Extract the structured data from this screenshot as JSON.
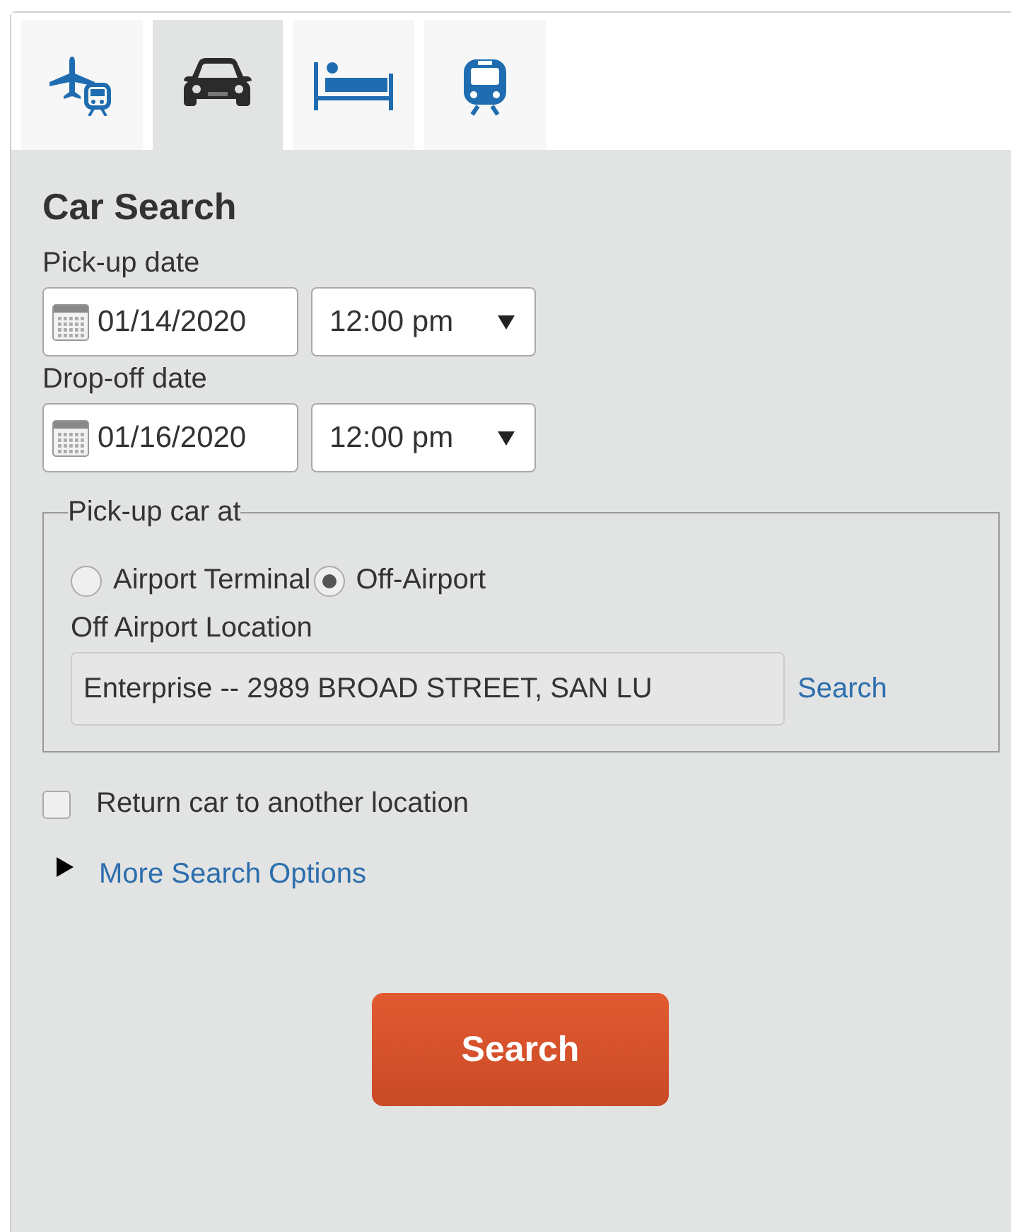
{
  "tabs": [
    {
      "kind": "flight-rail",
      "selected": false
    },
    {
      "kind": "car",
      "selected": true
    },
    {
      "kind": "hotel",
      "selected": false
    },
    {
      "kind": "rail",
      "selected": false
    }
  ],
  "title": "Car Search",
  "dates": [
    {
      "label": "Pick-up date",
      "date": "01/14/2020",
      "time": "12:00 pm"
    },
    {
      "label": "Drop-off date",
      "date": "01/16/2020",
      "time": "12:00 pm"
    }
  ],
  "pickup_location": {
    "legend": "Pick-up car at",
    "options": [
      {
        "label": "Airport Terminal",
        "selected": false
      },
      {
        "label": "Off-Airport",
        "selected": true
      }
    ],
    "field_label": "Off Airport Location",
    "field_value": "Enterprise -- 2989 BROAD STREET, SAN LU",
    "search_link": "Search"
  },
  "return_elsewhere": {
    "label": "Return car to another location",
    "checked": false
  },
  "more_options": {
    "label": "More Search Options",
    "expanded": false
  },
  "search_button": "Search"
}
